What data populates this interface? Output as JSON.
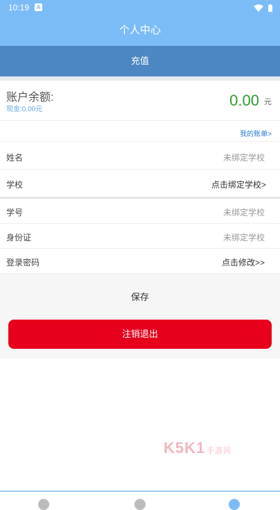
{
  "statusbar": {
    "time": "10:19",
    "a_badge": "A"
  },
  "header": {
    "title": "个人中心"
  },
  "recharge": {
    "label": "充值"
  },
  "balance": {
    "label": "账户余额:",
    "cash": "现金:0.00元",
    "amount": "0.00",
    "unit": "元"
  },
  "bill": {
    "link": "我的账单>"
  },
  "form": {
    "rows": [
      {
        "label": "姓名",
        "value": "未绑定学校"
      },
      {
        "label": "学校",
        "value": "点击绑定学校>"
      },
      {
        "label": "学号",
        "value": "未绑定学校"
      },
      {
        "label": "身份证",
        "value": "未绑定学校"
      },
      {
        "label": "登录密码",
        "value": "点击修改>>"
      }
    ]
  },
  "actions": {
    "save": "保存",
    "logout": "注销退出"
  },
  "watermark": {
    "brand": "K5K1",
    "sub": "手游网"
  },
  "colors": {
    "header": "#7cbcf6",
    "recharge": "#4d87c3",
    "logout": "#e6001c",
    "amount": "#2e9b2e"
  }
}
